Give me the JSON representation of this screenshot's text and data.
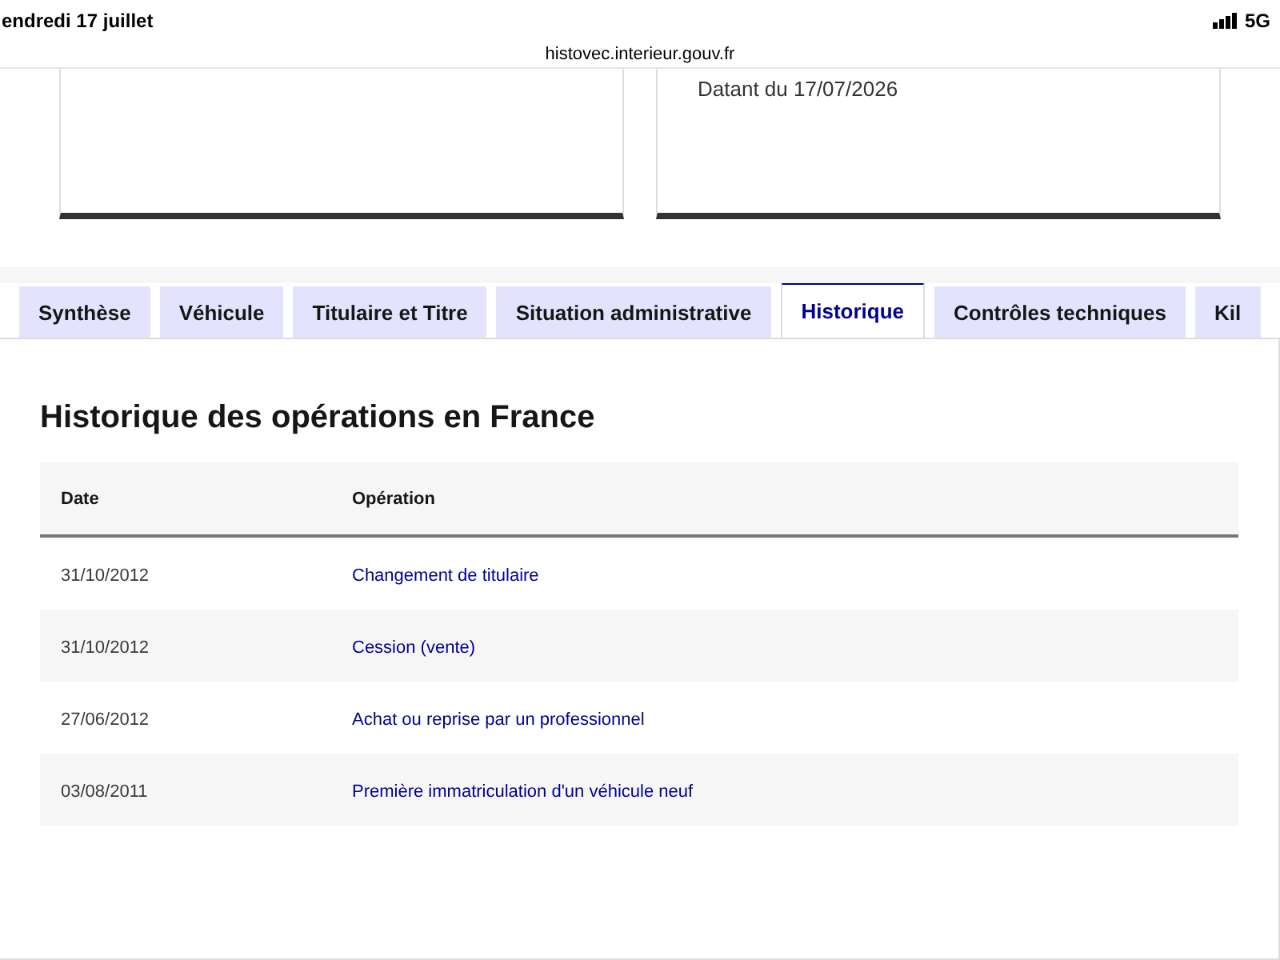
{
  "status_bar": {
    "date": "endredi 17 juillet",
    "network": "5G"
  },
  "address_bar": {
    "url": "histovec.interieur.gouv.fr"
  },
  "cards": [
    {
      "kind": "blank"
    },
    {
      "kind": "dated",
      "text": "Datant du 17/07/2026"
    }
  ],
  "tabs": [
    {
      "label": "Synthèse",
      "selected": false
    },
    {
      "label": "Véhicule",
      "selected": false
    },
    {
      "label": "Titulaire et Titre",
      "selected": false
    },
    {
      "label": "Situation administrative",
      "selected": false
    },
    {
      "label": "Historique",
      "selected": true
    },
    {
      "label": "Contrôles techniques",
      "selected": false
    },
    {
      "label": "Kil",
      "selected": false
    }
  ],
  "panel": {
    "title": "Historique des opérations en France",
    "table": {
      "columns": [
        "Date",
        "Opération"
      ],
      "rows": [
        {
          "date": "31/10/2012",
          "operation": "Changement de titulaire"
        },
        {
          "date": "31/10/2012",
          "operation": "Cession (vente)"
        },
        {
          "date": "27/06/2012",
          "operation": "Achat ou reprise par un professionnel"
        },
        {
          "date": "03/08/2011",
          "operation": "Première immatriculation d'un véhicule neuf"
        }
      ]
    }
  }
}
